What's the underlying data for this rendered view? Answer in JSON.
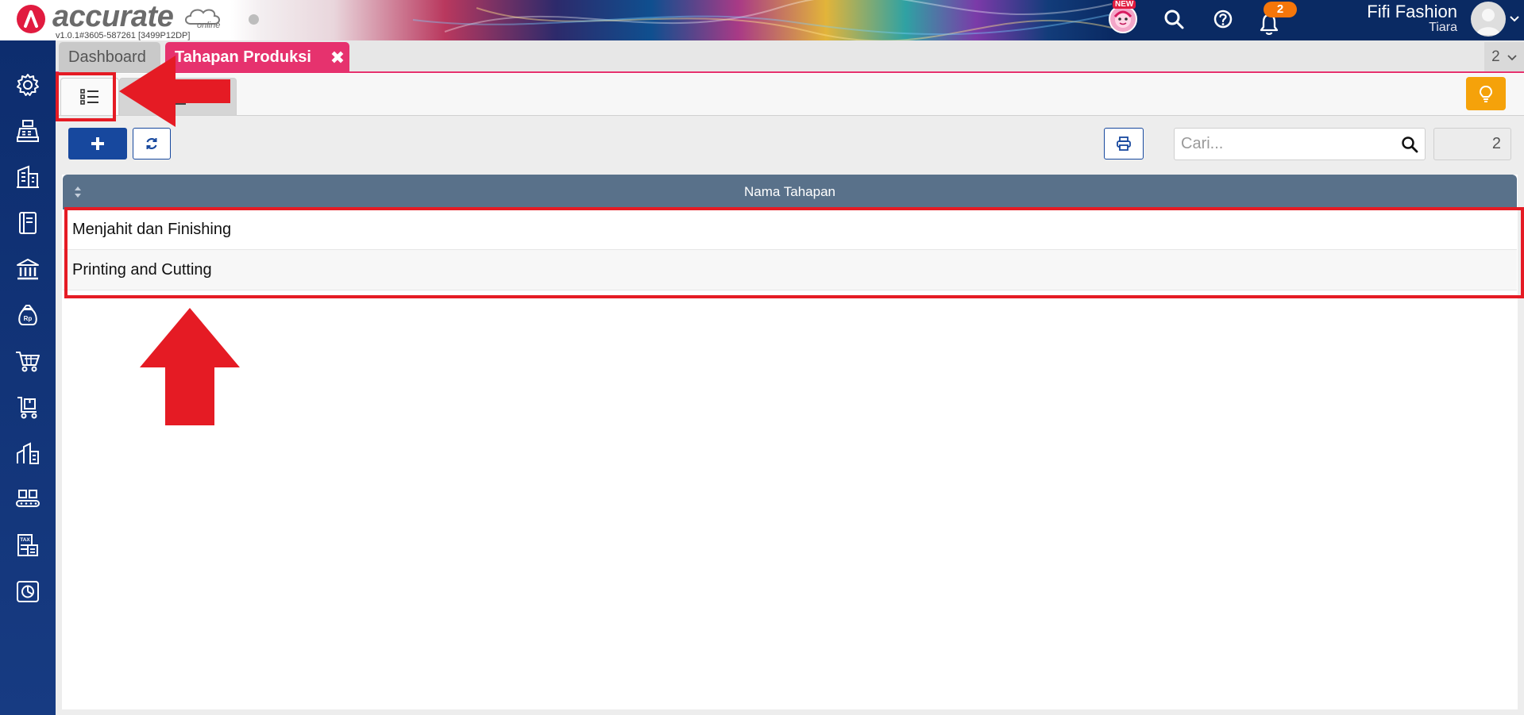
{
  "app": {
    "logo_text": "accurate",
    "logo_sub": "online",
    "version": "v1.0.1#3605-587261 [3499P12DP]"
  },
  "header": {
    "new_badge": "NEW",
    "notification_count": "2",
    "company_name": "Fifi Fashion",
    "user_name": "Tiara"
  },
  "sidebar": {
    "items": [
      {
        "name": "settings-icon"
      },
      {
        "name": "cash-register-icon"
      },
      {
        "name": "building-icon"
      },
      {
        "name": "ledger-book-icon"
      },
      {
        "name": "bank-icon"
      },
      {
        "name": "money-bag-icon"
      },
      {
        "name": "shopping-cart-icon"
      },
      {
        "name": "purchase-cart-icon"
      },
      {
        "name": "inventory-icon"
      },
      {
        "name": "production-icon"
      },
      {
        "name": "tax-report-icon"
      },
      {
        "name": "chart-report-icon"
      }
    ]
  },
  "tabs": {
    "items": [
      {
        "label": "Dashboard"
      },
      {
        "label": "Tahapan Produksi"
      }
    ],
    "close_glyph": "✖",
    "open_count": "2"
  },
  "toolbar": {
    "search_placeholder": "Cari...",
    "record_count": "2"
  },
  "table": {
    "columns": [
      "Nama Tahapan"
    ],
    "rows": [
      {
        "nama_tahapan": "Menjahit dan Finishing"
      },
      {
        "nama_tahapan": "Printing and Cutting"
      }
    ]
  },
  "colors": {
    "primary": "#17489e",
    "tab_active": "#e6326e",
    "table_header": "#59718a",
    "annotation": "#e51b24",
    "bulb_button": "#f5a20a",
    "notification": "#f5760a"
  }
}
